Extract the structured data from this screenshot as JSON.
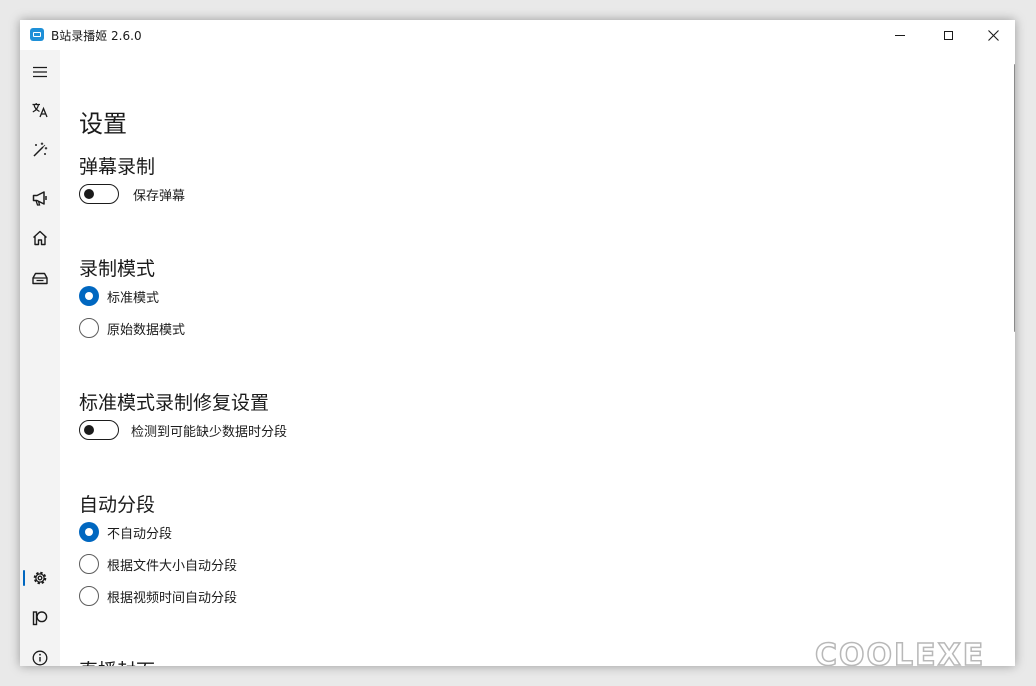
{
  "window": {
    "title": "B站录播姬 2.6.0"
  },
  "nav": {
    "items": [
      {
        "icon": "hamburger-menu-icon"
      },
      {
        "icon": "language-icon"
      },
      {
        "icon": "magic-wand-icon"
      },
      {
        "icon": "megaphone-icon"
      },
      {
        "icon": "home-icon"
      },
      {
        "icon": "toolbox-icon"
      },
      {
        "icon": "settings-gear-icon",
        "selected": true
      },
      {
        "icon": "patreon-icon"
      },
      {
        "icon": "info-icon"
      }
    ]
  },
  "settings": {
    "title": "设置",
    "danmaku": {
      "title": "弹幕录制",
      "toggle_label": "保存弹幕",
      "enabled": false
    },
    "record_mode": {
      "title": "录制模式",
      "options": [
        "标准模式",
        "原始数据模式"
      ],
      "selected": 0
    },
    "repair": {
      "title": "标准模式录制修复设置",
      "toggle_label": "检测到可能缺少数据时分段",
      "enabled": false
    },
    "auto_split": {
      "title": "自动分段",
      "options": [
        "不自动分段",
        "根据文件大小自动分段",
        "根据视频时间自动分段"
      ],
      "selected": 0
    },
    "cover": {
      "title": "直播封面"
    }
  },
  "watermark": {
    "text": "coolexe"
  },
  "colors": {
    "accent": "#0067c0",
    "nav_bg": "#f3f3f3",
    "app_icon": "#1e90d8"
  }
}
